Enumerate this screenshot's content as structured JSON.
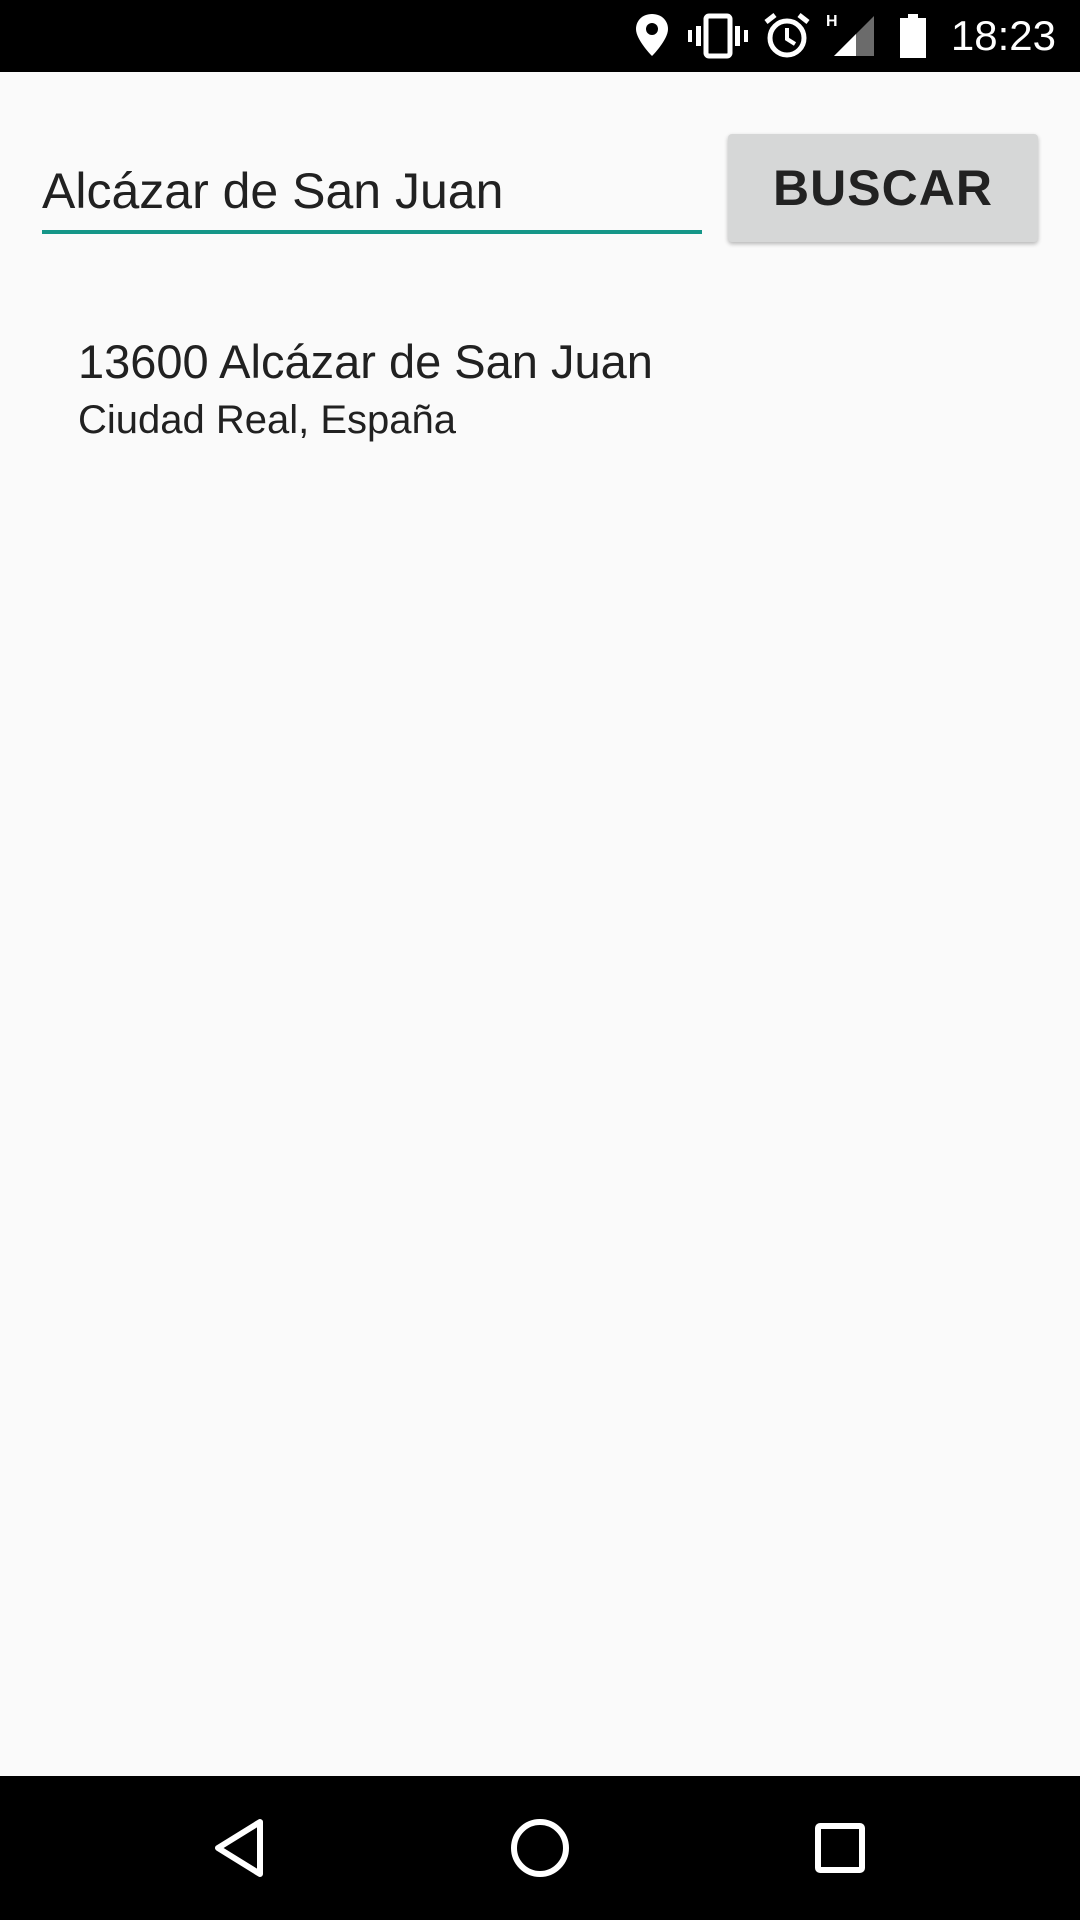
{
  "status_bar": {
    "time": "18:23",
    "icons": [
      "location-icon",
      "vibrate-icon",
      "alarm-icon",
      "signal-h-icon",
      "battery-icon"
    ],
    "network_type": "H"
  },
  "search": {
    "value": "Alcázar de San Juan",
    "underline_color": "#159688",
    "button_label": "BUSCAR"
  },
  "results": [
    {
      "line1": "13600 Alcázar de San Juan",
      "line2": "Ciudad Real, España"
    }
  ],
  "nav_bar": {
    "icons": [
      "back-icon",
      "home-icon",
      "recents-icon"
    ]
  }
}
